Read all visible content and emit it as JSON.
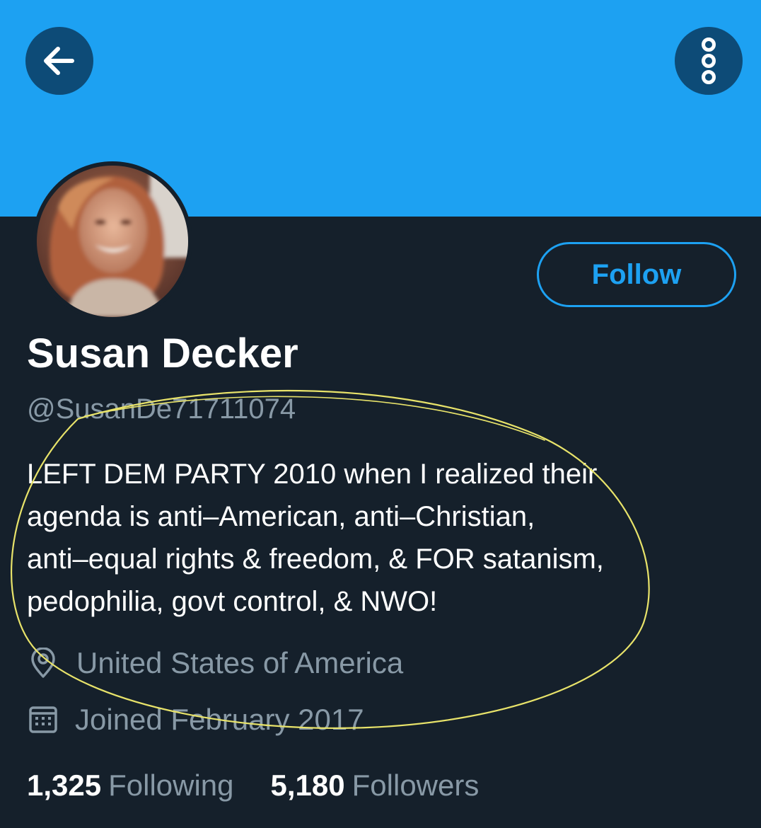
{
  "header": {
    "back_icon": "arrow-left-icon",
    "more_icon": "more-vertical-icon",
    "banner_color": "#1da1f2",
    "button_color": "#0d4b77"
  },
  "profile": {
    "avatar": "profile-photo",
    "follow_label": "Follow",
    "name": "Susan Decker",
    "handle": "@SusanDe71711074",
    "bio_lines": [
      "LEFT DEM PARTY 2010 when I realized their",
      "agenda is anti–American, anti–Christian,",
      "anti–equal rights & freedom, & FOR satanism,",
      "pedophilia, govt control, & NWO!"
    ],
    "location": "United States of America",
    "location_icon": "location-pin-icon",
    "joined": "Joined February 2017",
    "joined_icon": "calendar-icon"
  },
  "stats": {
    "following_count": "1,325",
    "following_label": "Following",
    "followers_count": "5,180",
    "followers_label": "Followers"
  },
  "colors": {
    "background": "#15202b",
    "accent": "#1da1f2",
    "secondary_text": "#8899a6",
    "annotation": "#e8e36a"
  }
}
